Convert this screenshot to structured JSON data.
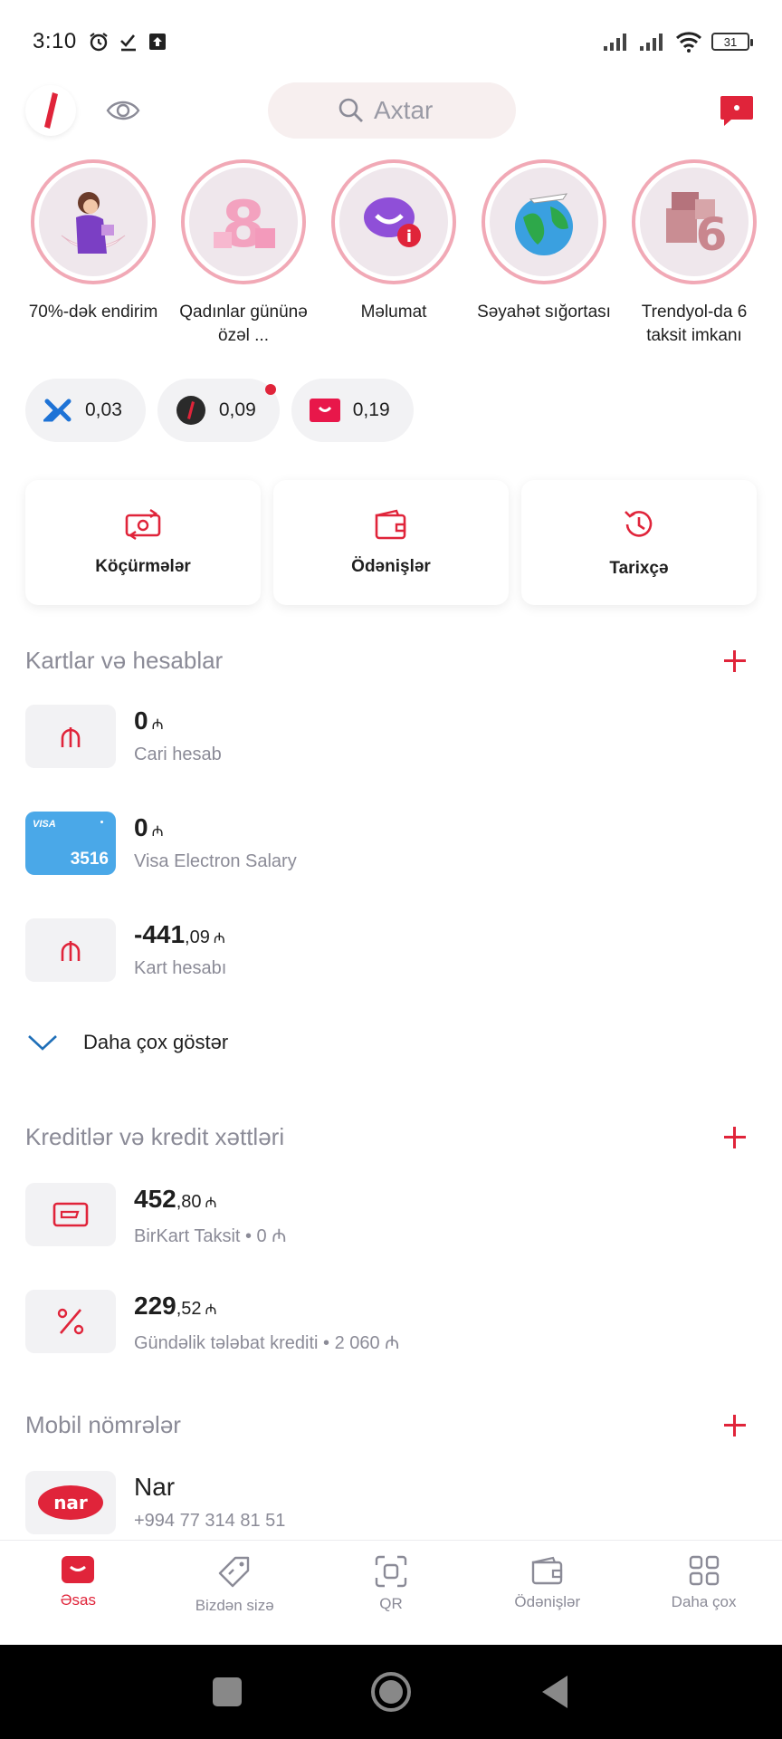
{
  "status_bar": {
    "time": "3:10",
    "battery": "31"
  },
  "search": {
    "placeholder": "Axtar"
  },
  "stories": [
    {
      "label": "70%-dək endirim"
    },
    {
      "label": "Qadınlar gününə özəl ..."
    },
    {
      "label": "Məlumat"
    },
    {
      "label": "Səyahət sığortası"
    },
    {
      "label": "Trendyol-da 6 taksit imkanı"
    }
  ],
  "chips": [
    {
      "value": "0,03"
    },
    {
      "value": "0,09"
    },
    {
      "value": "0,19"
    }
  ],
  "actions": [
    {
      "label": "Köçürmələr"
    },
    {
      "label": "Ödənişlər"
    },
    {
      "label": "Tarixçə"
    }
  ],
  "cards_section": {
    "title": "Kartlar və hesablar",
    "items": [
      {
        "amount_int": "0",
        "amount_frac": "",
        "currency": "₼",
        "subtitle": "Cari hesab"
      },
      {
        "amount_int": "0",
        "amount_frac": "",
        "currency": "₼",
        "subtitle": "Visa Electron Salary",
        "card_brand": "VISA",
        "card_last4": "3516"
      },
      {
        "amount_int": "-441",
        "amount_frac": ",09",
        "currency": "₼",
        "subtitle": "Kart hesabı"
      }
    ],
    "more_label": "Daha çox göstər"
  },
  "credits_section": {
    "title": "Kreditlər və kredit xəttləri",
    "items": [
      {
        "amount_int": "452",
        "amount_frac": ",80",
        "currency": "₼",
        "subtitle": "BirKart Taksit • 0 ₼"
      },
      {
        "amount_int": "229",
        "amount_frac": ",52",
        "currency": "₼",
        "subtitle": "Gündəlik tələbat krediti • 2 060 ₼"
      }
    ]
  },
  "mobile_section": {
    "title": "Mobil nömrələr",
    "items": [
      {
        "name": "Nar",
        "subtitle": "+994 77 314 81 51",
        "logo_text": "nar"
      }
    ]
  },
  "bottom_nav": [
    {
      "label": "Əsas",
      "active": true
    },
    {
      "label": "Bizdən sizə"
    },
    {
      "label": "QR"
    },
    {
      "label": "Ödənişlər"
    },
    {
      "label": "Daha çox"
    }
  ],
  "colors": {
    "accent": "#e0243a",
    "muted": "#8b8b97",
    "tile_bg": "#f2f2f4",
    "visa_bg": "#4aa8e8"
  }
}
